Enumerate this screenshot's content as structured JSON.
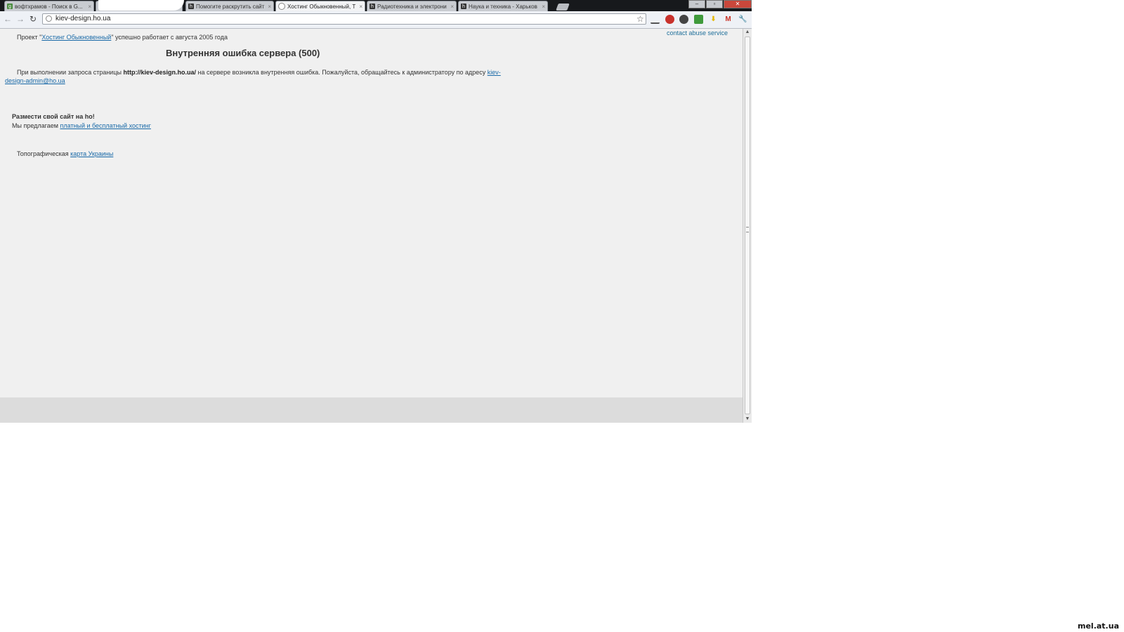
{
  "browser": {
    "tabs": [
      {
        "title": "вофтхрамов - Поиск в G...",
        "favicon": "google-icon"
      },
      {
        "title": "",
        "favicon": "page-icon"
      },
      {
        "title": "Помогите раскрутить сайт",
        "favicon": "ho-icon"
      },
      {
        "title": "Хостинг Обыкновенный, Т",
        "favicon": "loading-icon",
        "active": true
      },
      {
        "title": "Радиотехника и электрони",
        "favicon": "ho-icon"
      },
      {
        "title": "Наука и техника - Харьков",
        "favicon": "ho-icon"
      }
    ],
    "tab_close_glyph": "×",
    "window_controls": {
      "minimize": "–",
      "maximize": "▫",
      "close": "✕"
    },
    "address": "kiev-design.ho.ua",
    "nav": {
      "back": "←",
      "forward": "→",
      "reload": "↻"
    },
    "star": "☆"
  },
  "page": {
    "abuse_link": "contact abuse service",
    "project_prefix": "Проект \"",
    "project_link": "Хостинг Обыкновенный",
    "project_suffix": "\" успешно работает с августа 2005 года",
    "heading": "Внутренняя ошибка сервера (500)",
    "error_prefix": "При выполнении запроса страницы ",
    "error_url": "http://kiev-design.ho.ua/",
    "error_middle": " на сервере возникла внутренняя ошибка. Пожалуйста, обращайтесь к администратору по адресу ",
    "error_email": "kiev-design-admin@ho.ua",
    "place_title": "Размести свой сайт на ho!",
    "invite_prefix": "Мы предлагаем ",
    "invite_link": "платный и бесплатный хостинг",
    "topo_prefix": "Топографическая ",
    "topo_link": "карта Украины"
  },
  "watermark": "mel.at.ua",
  "colors": {
    "link": "#1a6aa8",
    "page_bg": "#f0f0f0",
    "tabstrip_bg": "#17191c",
    "close_button": "#c9473b"
  }
}
